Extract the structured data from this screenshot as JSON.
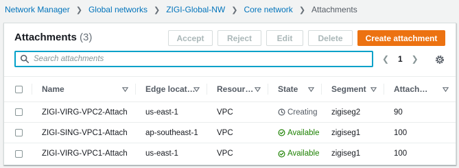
{
  "breadcrumb": {
    "items": [
      "Network Manager",
      "Global networks",
      "ZIGI-Global-NW",
      "Core network"
    ],
    "current": "Attachments"
  },
  "header": {
    "title": "Attachments",
    "count": "(3)"
  },
  "actions": {
    "accept": "Accept",
    "reject": "Reject",
    "edit": "Edit",
    "delete": "Delete",
    "create": "Create attachment"
  },
  "search": {
    "placeholder": "Search attachments",
    "value": ""
  },
  "pagination": {
    "page": "1"
  },
  "table": {
    "columns": [
      "Name",
      "Edge locat…",
      "Resour…",
      "State",
      "Segment",
      "Attach…"
    ],
    "rows": [
      {
        "name": "ZIGI-VIRG-VPC2-Attach",
        "edge": "us-east-1",
        "resource": "VPC",
        "state": "Creating",
        "state_kind": "creating",
        "segment": "zigiseg2",
        "attach": "90"
      },
      {
        "name": "ZIGI-SING-VPC1-Attach",
        "edge": "ap-southeast-1",
        "resource": "VPC",
        "state": "Available",
        "state_kind": "available",
        "segment": "zigiseg1",
        "attach": "100"
      },
      {
        "name": "ZIGI-VIRG-VPC1-Attach",
        "edge": "us-east-1",
        "resource": "VPC",
        "state": "Available",
        "state_kind": "available",
        "segment": "zigiseg1",
        "attach": "100"
      }
    ]
  },
  "icons": {
    "search": "search-icon",
    "prev": "chevron-left-icon",
    "next": "chevron-right-icon",
    "settings": "gear-icon",
    "sort": "sort-caret-down-icon",
    "creating": "clock-icon",
    "available": "check-circle-icon"
  },
  "colors": {
    "link": "#0073bb",
    "primary": "#ec7211",
    "focus": "#00a1c9",
    "success": "#1d8102",
    "disabled_text": "#aab7b8"
  }
}
